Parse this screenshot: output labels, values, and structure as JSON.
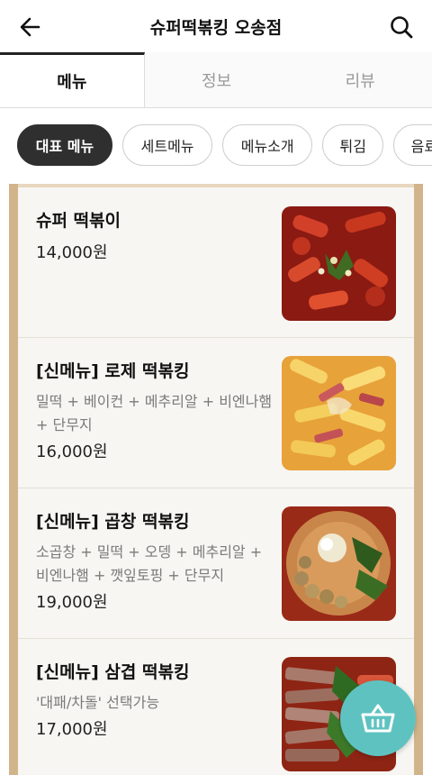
{
  "header": {
    "title": "슈퍼떡볶킹 오송점",
    "back_icon": "arrow-left-icon",
    "search_icon": "search-icon"
  },
  "tabs": [
    {
      "label": "메뉴",
      "active": true
    },
    {
      "label": "정보",
      "active": false
    },
    {
      "label": "리뷰",
      "active": false
    }
  ],
  "chips": [
    {
      "label": "대표 메뉴",
      "active": true
    },
    {
      "label": "세트메뉴",
      "active": false
    },
    {
      "label": "메뉴소개",
      "active": false
    },
    {
      "label": "튀김",
      "active": false
    },
    {
      "label": "음료",
      "active": false
    }
  ],
  "menu_items": [
    {
      "name": "슈퍼 떡볶이",
      "description": "",
      "price": "14,000원",
      "image": "tteokbokki-photo"
    },
    {
      "name": "[신메뉴] 로제 떡볶킹",
      "description": "밀떡 + 베이컨 + 메추리알 + 비엔나햄 + 단무지",
      "price": "16,000원",
      "image": "rose-tteokbokki-photo"
    },
    {
      "name": "[신메뉴] 곱창 떡볶킹",
      "description": "소곱창 + 밀떡 + 오뎅 + 메추리알 + 비엔나햄 + 깻잎토핑 + 단무지",
      "price": "19,000원",
      "image": "gopchang-tteokbokki-photo"
    },
    {
      "name": "[신메뉴] 삼겹 떡볶킹",
      "description": "'대패/차돌' 선택가능",
      "price": "17,000원",
      "image": "samgyeop-tteokbokki-photo"
    }
  ],
  "cart": {
    "icon": "basket-icon",
    "color": "#5ec3c0"
  },
  "colors": {
    "frame": "#d2b48c",
    "chip_active": "#2f2f2f"
  }
}
